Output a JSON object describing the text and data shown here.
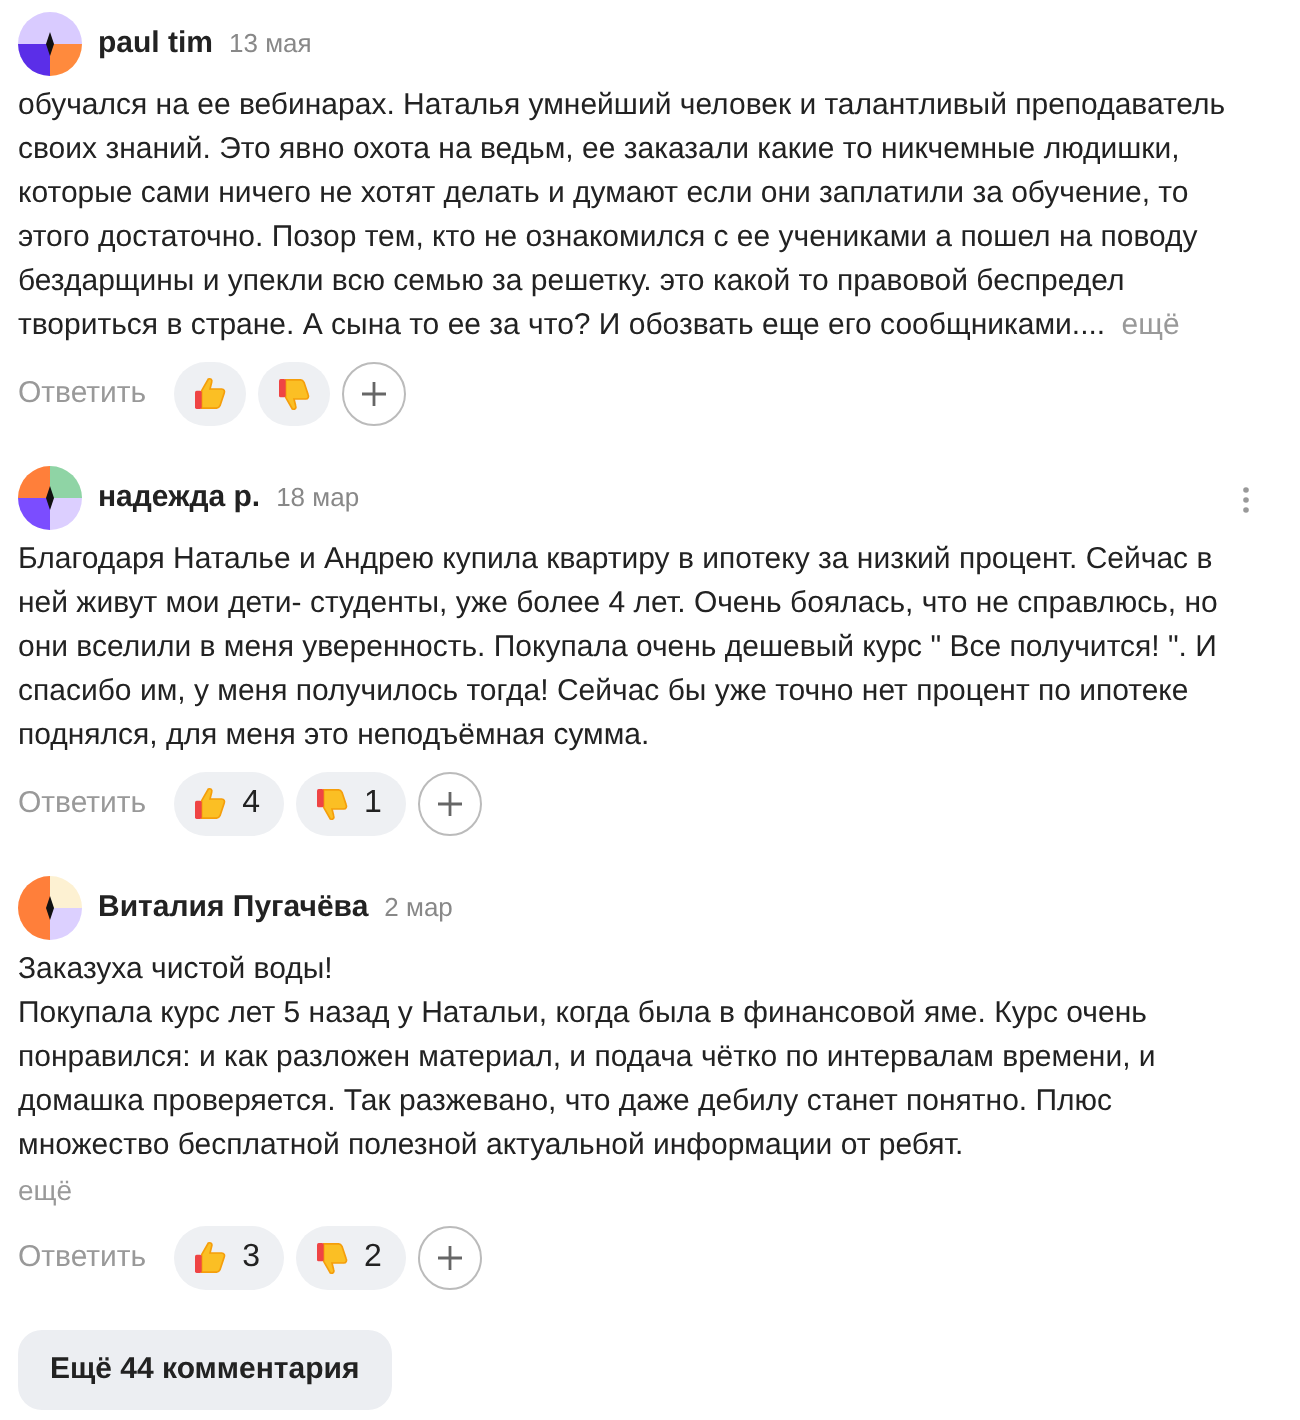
{
  "comments": [
    {
      "author": "paul tim",
      "date": "13 мая",
      "avatar": {
        "kind": "violet"
      },
      "menu": false,
      "text": "обучался на ее вебинарах. Наталья умнейший человек и талантливый преподаватель своих знаний. Это явно охота на ведьм, ее заказали какие то никчемные людишки, которые сами ничего не хотят делать и думают если они заплатили за обучение, то этого достаточно. Позор тем, кто не ознакомился с ее учениками а пошел на поводу бездарщины и упекли всю семью за решетку. это какой то правовой беспредел твориться в стране. А сына то ее за что? И обозвать еще его сообщниками....",
      "more": {
        "label": "ещё",
        "inline": true
      },
      "reply": "Ответить"
    },
    {
      "author": "надежда р.",
      "date": "18 мар",
      "avatar": {
        "kind": "quad"
      },
      "menu": true,
      "text": "Благодаря Наталье и Андрею купила квартиру в ипотеку за низкий процент. Сейчас в ней живут мои дети- студенты, уже более 4 лет. Очень боялась, что не справлюсь, но они вселили в меня уверенность. Покупала очень дешевый курс \" Все получится! \". И спасибо им, у меня получилось тогда! Сейчас бы уже точно нет процент по ипотеке поднялся, для меня это неподъёмная сумма.",
      "reply": "Ответить",
      "likes": "4",
      "dislikes": "1"
    },
    {
      "author": "Виталия Пугачёва",
      "date": "2 мар",
      "avatar": {
        "kind": "cream"
      },
      "menu": false,
      "text": "Заказуха чистой воды!\nПокупала курс лет 5 назад у Натальи, когда была в финансовой яме. Курс очень понравился: и как разложен материал, и подача чётко по интервалам времени, и домашка проверяется. Так разжевано, что даже дебилу станет понятно. Плюс множество бесплатной полезной актуальной информации от ребят.",
      "more": {
        "label": "ещё",
        "inline": false
      },
      "reply": "Ответить",
      "likes": "3",
      "dislikes": "2"
    }
  ],
  "more_comments": "Ещё 44 комментария"
}
